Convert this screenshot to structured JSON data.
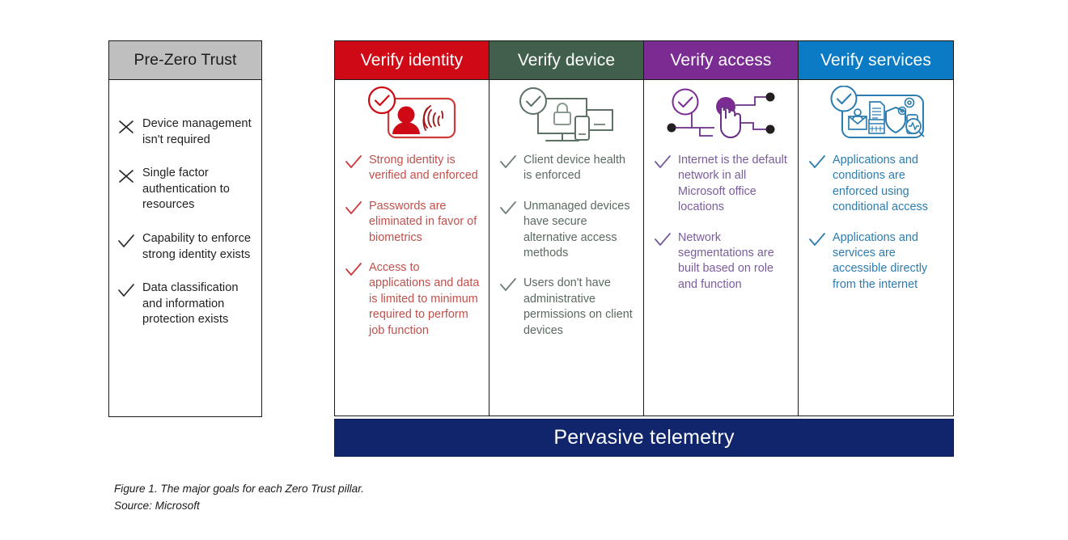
{
  "figure": {
    "caption_line1": "Figure 1. The major goals for each Zero Trust pillar.",
    "caption_line2": "Source: Microsoft"
  },
  "prezero": {
    "title": "Pre-Zero Trust",
    "header_bg": "#bfbfbf",
    "items": [
      {
        "mark": "cross-icon",
        "text": "Device management isn't required"
      },
      {
        "mark": "cross-icon",
        "text": "Single factor authentication to resources"
      },
      {
        "mark": "check-icon",
        "text": "Capability to enforce strong identity exists"
      },
      {
        "mark": "check-icon",
        "text": "Data classification and information protection exists"
      }
    ]
  },
  "pillars": [
    {
      "title": "Verify identity",
      "color": "#cf0a16",
      "text_color": "#c1504b",
      "icon": "id-card-fingerprint-icon",
      "goals": [
        "Strong identity is verified and enforced",
        "Passwords are eliminated in favor of biometrics",
        "Access to applications and data is limited to minimum required to perform job function"
      ]
    },
    {
      "title": "Verify device",
      "color": "#41604c",
      "text_color": "#5a6a5f",
      "icon": "devices-lock-icon",
      "goals": [
        "Client device health is enforced",
        "Unmanaged devices have secure alternative access methods",
        "Users don't have administrative permissions on client devices"
      ]
    },
    {
      "title": "Verify access",
      "color": "#7b2c93",
      "text_color": "#7a5c9e",
      "icon": "network-hand-click-icon",
      "goals": [
        "Internet is the default network in all Microsoft office locations",
        "Network segmentations are built based on role and function"
      ]
    },
    {
      "title": "Verify services",
      "color": "#0a7bc4",
      "text_color": "#2b7cb0",
      "icon": "services-apps-icon",
      "goals": [
        "Applications and conditions are enforced using conditional access",
        "Applications and services are accessible directly from the internet"
      ]
    }
  ],
  "telemetry": {
    "label": "Pervasive telemetry",
    "bg": "#10256b"
  }
}
